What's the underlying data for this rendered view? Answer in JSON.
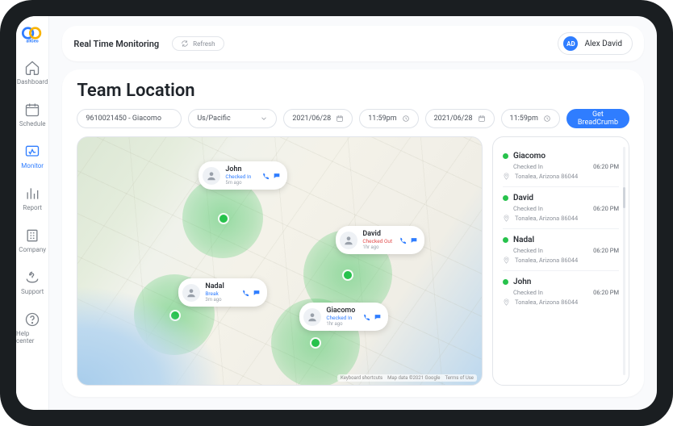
{
  "brand": {
    "name": "allGeo"
  },
  "sidebar": {
    "items": [
      {
        "label": "Dashboard"
      },
      {
        "label": "Schedule"
      },
      {
        "label": "Monitor"
      },
      {
        "label": "Report"
      },
      {
        "label": "Company"
      },
      {
        "label": "Support"
      },
      {
        "label": "Help center"
      }
    ]
  },
  "header": {
    "title": "Real Time Monitoring",
    "refresh_label": "Refresh",
    "user": {
      "initials": "AD",
      "name": "Alex David"
    }
  },
  "page": {
    "title": "Team Location"
  },
  "filters": {
    "team": "9610021450 - Giacomo",
    "timezone": "Us/Pacific",
    "start_date": "2021/06/28",
    "start_time": "11:59pm",
    "end_date": "2021/06/28",
    "end_time": "11:59pm",
    "action_label": "Get BreadCrumb"
  },
  "map": {
    "credit": "Google",
    "attr_shortcuts": "Keyboard shortcuts",
    "attr_mapdata": "Map data ©2021 Google",
    "attr_terms": "Terms of Use",
    "cards": [
      {
        "name": "John",
        "status": "Checked In",
        "time": "5m ago",
        "out": false
      },
      {
        "name": "David",
        "status": "Checked Out",
        "time": "1hr ago",
        "out": true
      },
      {
        "name": "Nadal",
        "status": "Break",
        "time": "3m ago",
        "out": false
      },
      {
        "name": "Giacomo",
        "status": "Checked In",
        "time": "1hr ago",
        "out": false
      }
    ]
  },
  "list": [
    {
      "name": "Giacomo",
      "status_label": "Checked In",
      "time": "06:20 PM",
      "location": "Tonalea, Arizona 86044"
    },
    {
      "name": "David",
      "status_label": "Checked In",
      "time": "06:20 PM",
      "location": "Tonalea, Arizona 86044"
    },
    {
      "name": "Nadal",
      "status_label": "Checked In",
      "time": "06:20 PM",
      "location": "Tonalea, Arizona 86044"
    },
    {
      "name": "John",
      "status_label": "Checked In",
      "time": "06:20 PM",
      "location": "Tonalea, Arizona 86044"
    }
  ]
}
